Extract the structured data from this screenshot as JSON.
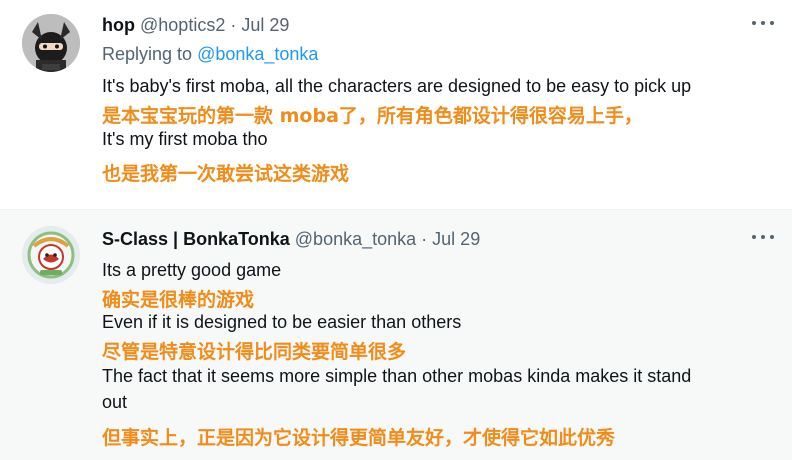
{
  "tweets": [
    {
      "author_name": "hop",
      "author_handle": "@hoptics2",
      "separator": "·",
      "date": "Jul 29",
      "replying_prefix": "Replying to",
      "replying_to": "@bonka_tonka",
      "lines": [
        "It's baby's first moba, all the characters are designed to be easy to pick up",
        "是本宝宝玩的第一款 moba了，所有角色都设计得很容易上手，",
        "It's my first moba tho",
        "也是我第一次敢尝试这类游戏"
      ]
    },
    {
      "author_name": "S-Class | BonkaTonka",
      "author_handle": "@bonka_tonka",
      "separator": "·",
      "date": "Jul 29",
      "lines": [
        "Its a pretty good game",
        "确实是很棒的游戏",
        "Even if it is designed to be easier than others",
        "尽管是特意设计得比同类要简单很多",
        "The fact that it seems more simple than other mobas kinda makes it stand",
        "out",
        "但事实上，正是因为它设计得更简单友好，才使得它如此优秀"
      ]
    }
  ],
  "colors": {
    "translation": "#f08c1a",
    "link": "#1d9bf0",
    "secondary": "#536471",
    "second_tweet_background": "#f7f9f9"
  },
  "icons": [
    "more-options-icon",
    "avatar-ninja-icon",
    "avatar-badge-icon"
  ]
}
